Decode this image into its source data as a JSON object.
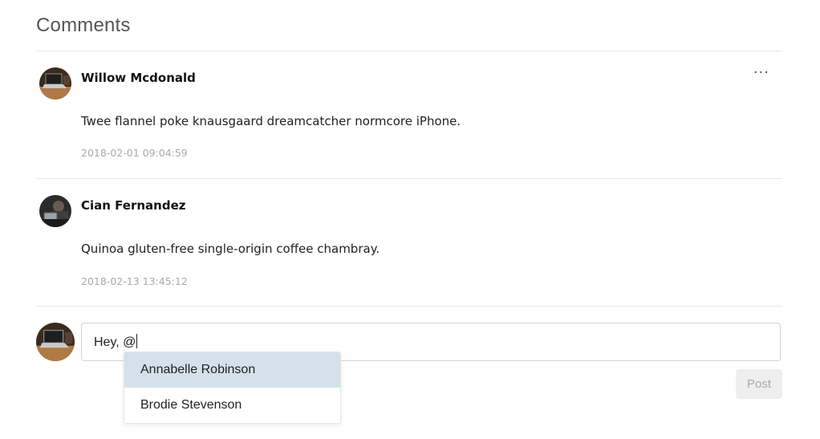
{
  "header": {
    "title": "Comments"
  },
  "comments": [
    {
      "author": "Willow Mcdonald",
      "body": "Twee flannel poke knausgaard dreamcatcher normcore iPhone.",
      "timestamp": "2018-02-01 09:04:59",
      "menu_label": "···"
    },
    {
      "author": "Cian Fernandez",
      "body": "Quinoa gluten-free single-origin coffee chambray.",
      "timestamp": "2018-02-13 13:45:12"
    }
  ],
  "composer": {
    "value": "Hey, @",
    "post_label": "Post"
  },
  "mention_dropdown": {
    "options": [
      "Annabelle Robinson",
      "Brodie Stevenson"
    ],
    "highlighted_index": 0
  },
  "colors": {
    "highlight": "#d4e1ea",
    "divider": "#e9e9e9",
    "timestamp": "#aaaaaa",
    "post_disabled_bg": "#eeeeee"
  }
}
